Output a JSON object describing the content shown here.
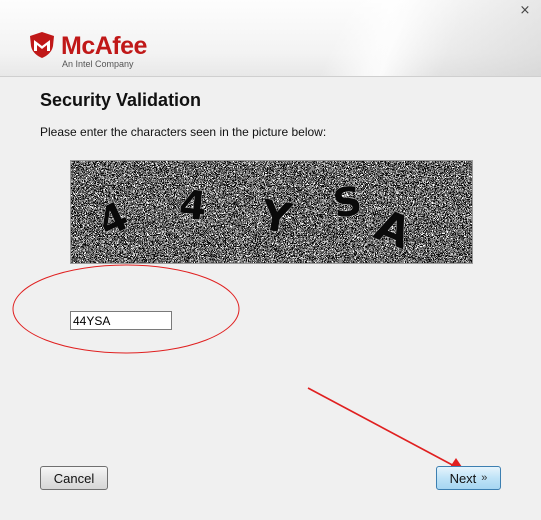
{
  "window": {
    "close_glyph": "×",
    "brand": "McAfee",
    "tagline": "An Intel Company"
  },
  "page": {
    "title": "Security Validation",
    "instructions": "Please enter the characters seen in the picture below:"
  },
  "captcha": {
    "image_text": "44YSA"
  },
  "form": {
    "answer_value": "44YSA"
  },
  "buttons": {
    "cancel_label": "Cancel",
    "next_label": "Next",
    "next_chevron": "»"
  },
  "colors": {
    "brand_red": "#c01818",
    "annotation_red": "#e02020",
    "next_button_blue": "#bfe3f7"
  },
  "icons": [
    "shield-logo-icon",
    "close-icon",
    "chevron-right-icon",
    "annotation-arrow-icon",
    "annotation-ellipse-icon"
  ]
}
